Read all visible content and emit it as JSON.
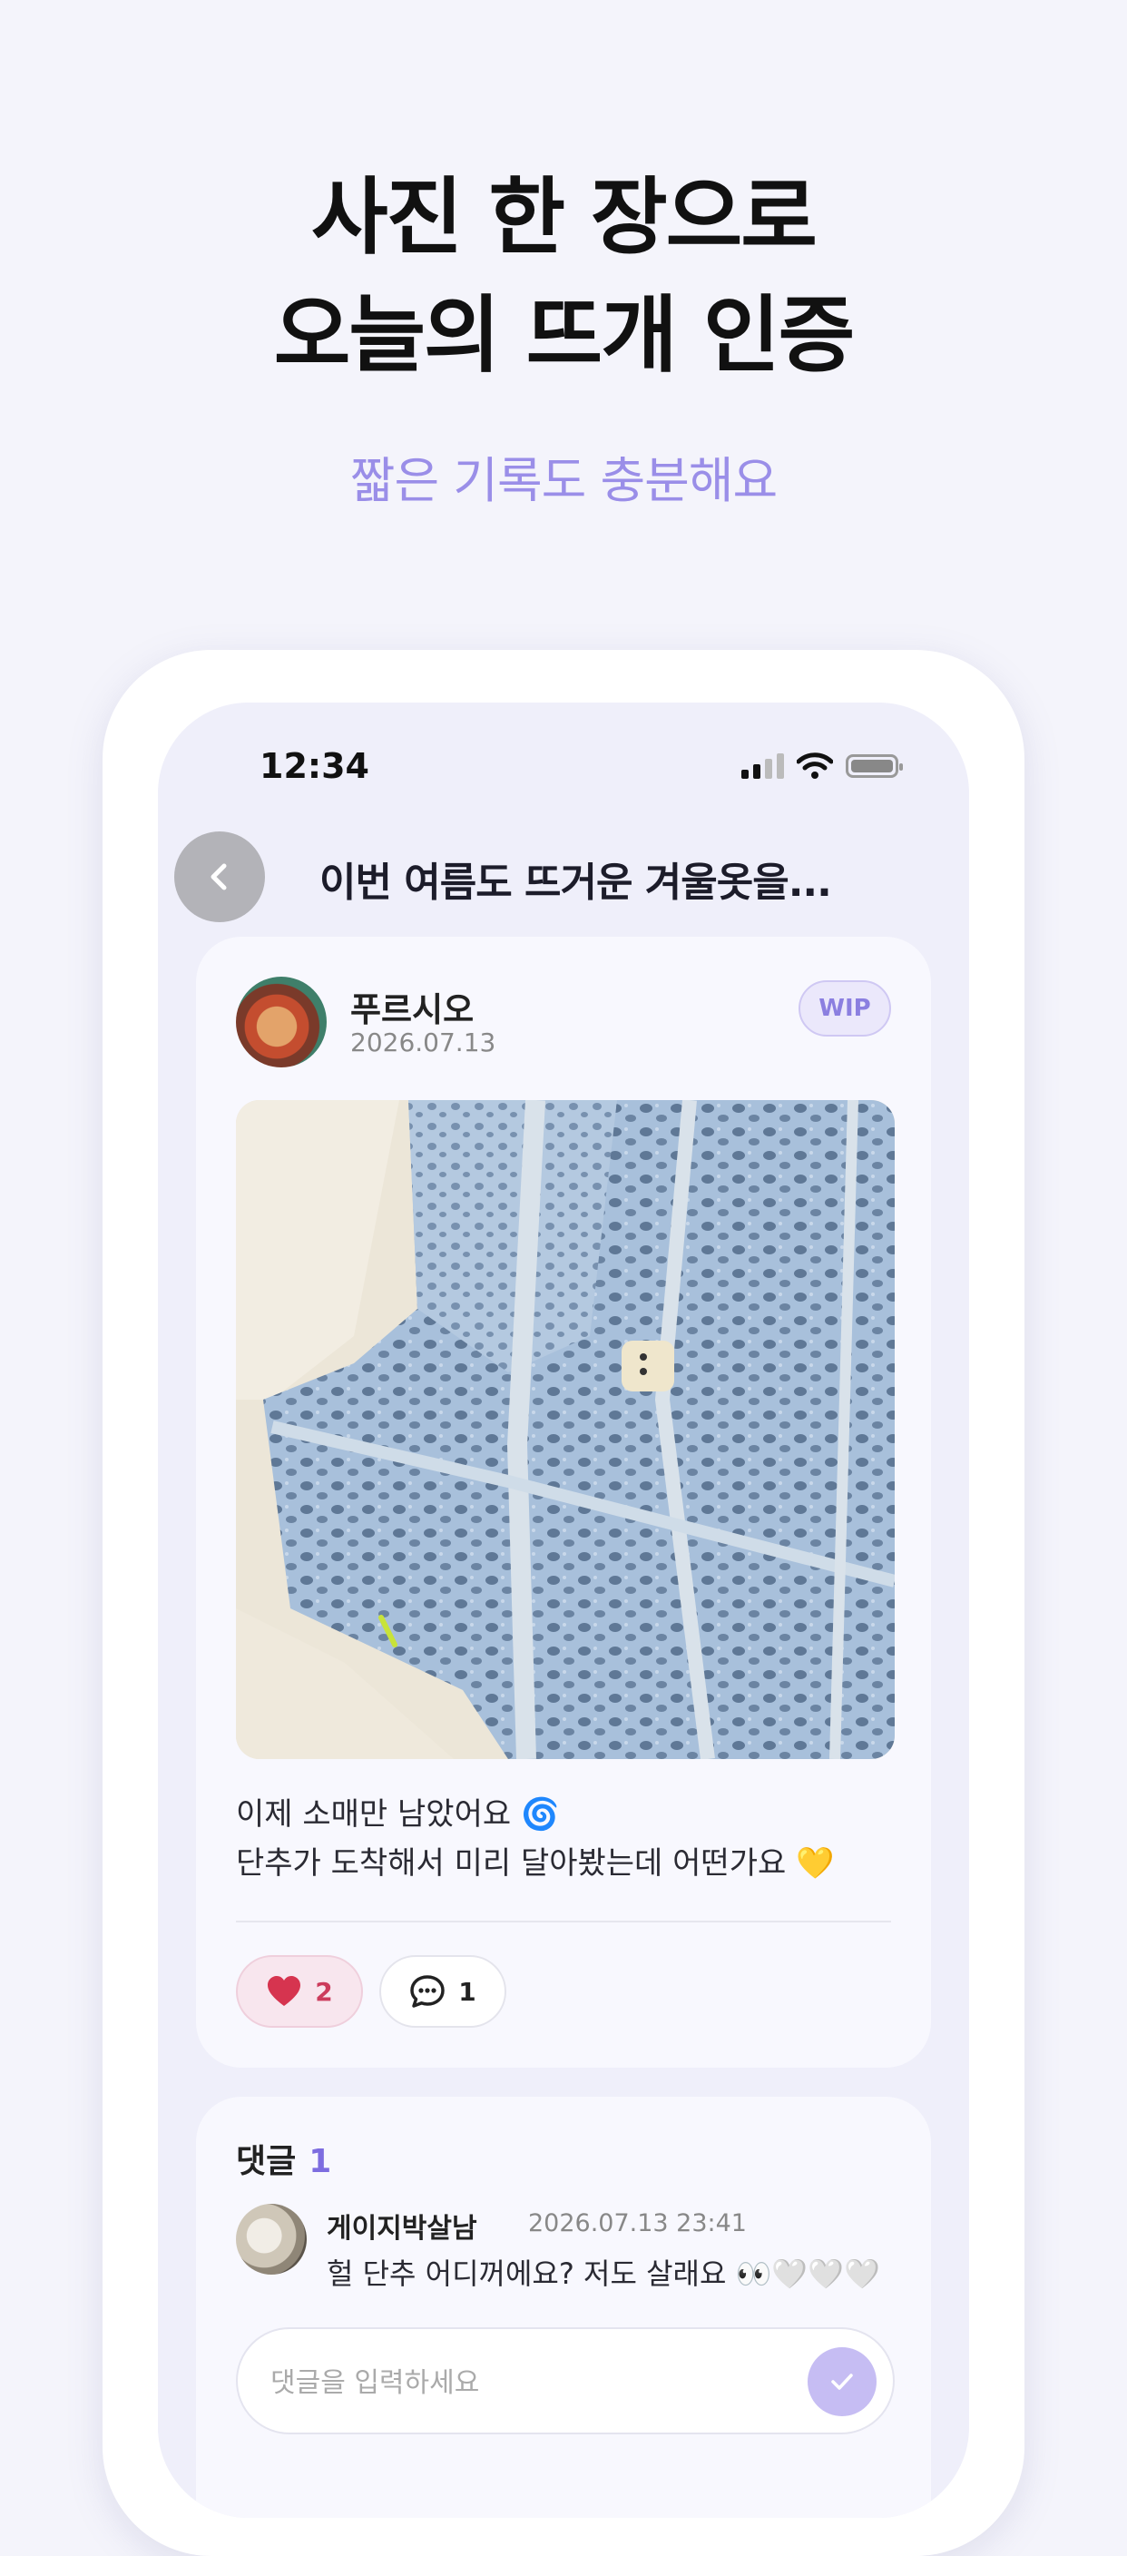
{
  "promo": {
    "headline_line1": "사진 한 장으로",
    "headline_line2": "오늘의 뜨개 인증",
    "subtitle": "짧은 기록도 충분해요"
  },
  "status_bar": {
    "time": "12:34",
    "icons": [
      "signal-icon",
      "wifi-icon",
      "battery-icon"
    ]
  },
  "nav": {
    "back_icon": "chevron-left-icon",
    "title": "이번 여름도 뜨거운 겨울옷을..."
  },
  "post": {
    "author": "푸르시오",
    "date": "2026.07.13",
    "badge": "WIP",
    "caption_line1": "이제 소매만 남았어요 🌀",
    "caption_line2": "단추가 도착해서 미리 달아봤는데 어떤가요 💛",
    "likes": "2",
    "comments": "1"
  },
  "comments_section": {
    "title": "댓글",
    "count": "1",
    "items": [
      {
        "author": "게이지박살남",
        "date": "2026.07.13 23:41",
        "text": "헐 단추 어디꺼에요? 저도 살래요 👀🤍🤍🤍"
      }
    ],
    "input_placeholder": "댓글을 입력하세요"
  },
  "colors": {
    "background": "#f4f4fb",
    "accent": "#9a8ee8",
    "like": "#cc3c5c"
  }
}
